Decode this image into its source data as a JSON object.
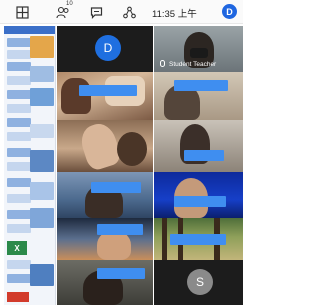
{
  "status_bar": {
    "participants_badge": "10",
    "time": "11:35 上午",
    "user_initial": "D"
  },
  "shared_screen": {
    "spreadsheet_icon_letter": "X"
  },
  "tiles": [
    {
      "id": "avatar-d",
      "initial": "D"
    },
    {
      "id": "student-teacher",
      "label": "Student Teacher"
    },
    {
      "id": "avatar-s",
      "initial": "S"
    }
  ]
}
